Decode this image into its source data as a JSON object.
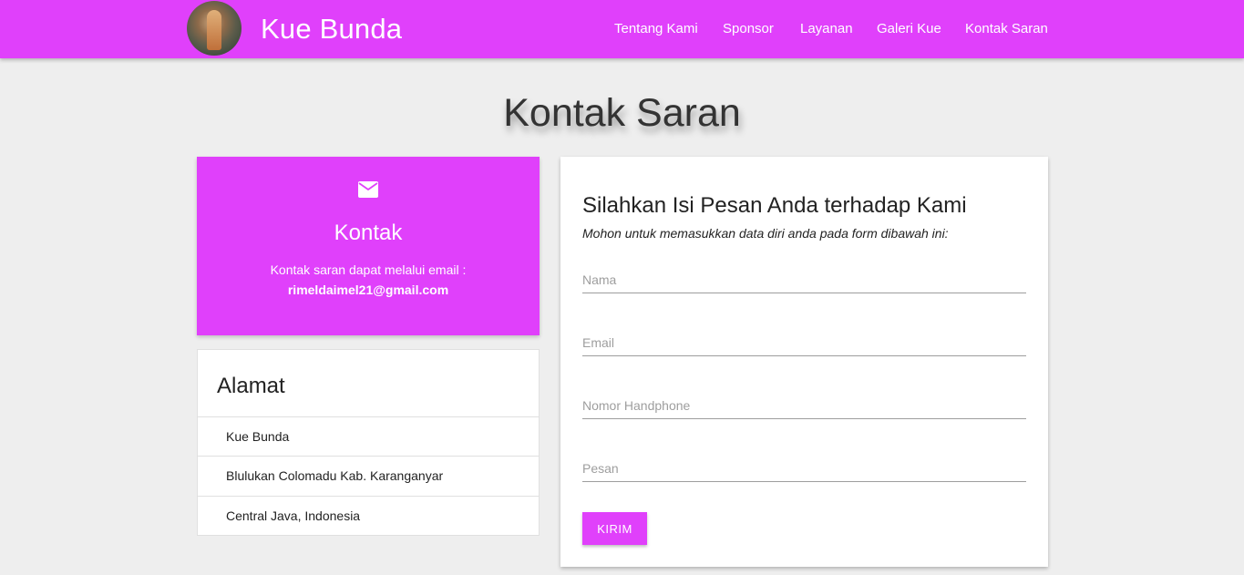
{
  "header": {
    "brand": "Kue Bunda",
    "nav": [
      {
        "label": "Tentang Kami"
      },
      {
        "label": "Sponsor"
      },
      {
        "label": "Layanan"
      },
      {
        "label": "Galeri Kue"
      },
      {
        "label": "Kontak Saran"
      }
    ]
  },
  "page": {
    "title": "Kontak Saran"
  },
  "kontak": {
    "icon": "mail-icon",
    "title": "Kontak",
    "text": "Kontak saran dapat melalui email :",
    "email": "rimeldaimel21@gmail.com"
  },
  "alamat": {
    "title": "Alamat",
    "items": [
      "Kue Bunda",
      "Blulukan Colomadu Kab. Karanganyar",
      "Central Java, Indonesia"
    ]
  },
  "form": {
    "title": "Silahkan Isi Pesan Anda terhadap Kami",
    "subtitle": "Mohon untuk memasukkan data diri anda pada form dibawah ini:",
    "fields": {
      "nama": {
        "placeholder": "Nama",
        "value": ""
      },
      "email": {
        "placeholder": "Email",
        "value": ""
      },
      "phone": {
        "placeholder": "Nomor Handphone",
        "value": ""
      },
      "pesan": {
        "placeholder": "Pesan",
        "value": ""
      }
    },
    "submit_label": "KIRIM"
  },
  "colors": {
    "accent": "#e040fb",
    "background": "#eeeeee"
  }
}
